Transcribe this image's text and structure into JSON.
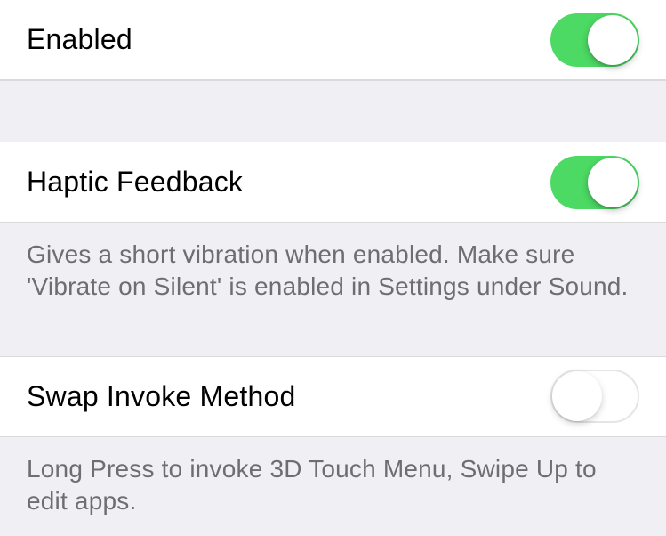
{
  "cells": {
    "enabled": {
      "label": "Enabled",
      "value": true
    },
    "haptic": {
      "label": "Haptic Feedback",
      "value": true,
      "footer": "Gives a short vibration when enabled. Make sure 'Vibrate on Silent' is enabled in Settings under Sound."
    },
    "swap": {
      "label": "Swap Invoke Method",
      "value": false,
      "footer": "Long Press to invoke 3D Touch Menu, Swipe Up to edit apps."
    }
  }
}
